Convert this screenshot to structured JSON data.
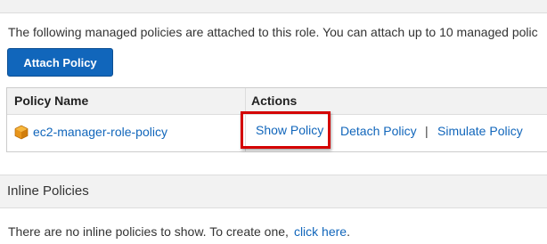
{
  "managed": {
    "intro": "The following managed policies are attached to this role. You can attach up to 10 managed polic",
    "attach_button": "Attach Policy",
    "columns": [
      "Policy Name",
      "Actions"
    ],
    "policies": [
      {
        "icon": "policy-cube-icon",
        "name": "ec2-manager-role-policy",
        "actions": [
          "Show Policy",
          "Detach Policy",
          "Simulate Policy"
        ],
        "separator": "|"
      }
    ],
    "highlight_color": "#d40000"
  },
  "inline": {
    "title": "Inline Policies",
    "empty_text": "There are no inline policies to show. To create one,",
    "link_text": "click here",
    "trailing": "."
  },
  "colors": {
    "link": "#1166bb",
    "button": "#1166bb",
    "band": "#f2f2f2"
  }
}
